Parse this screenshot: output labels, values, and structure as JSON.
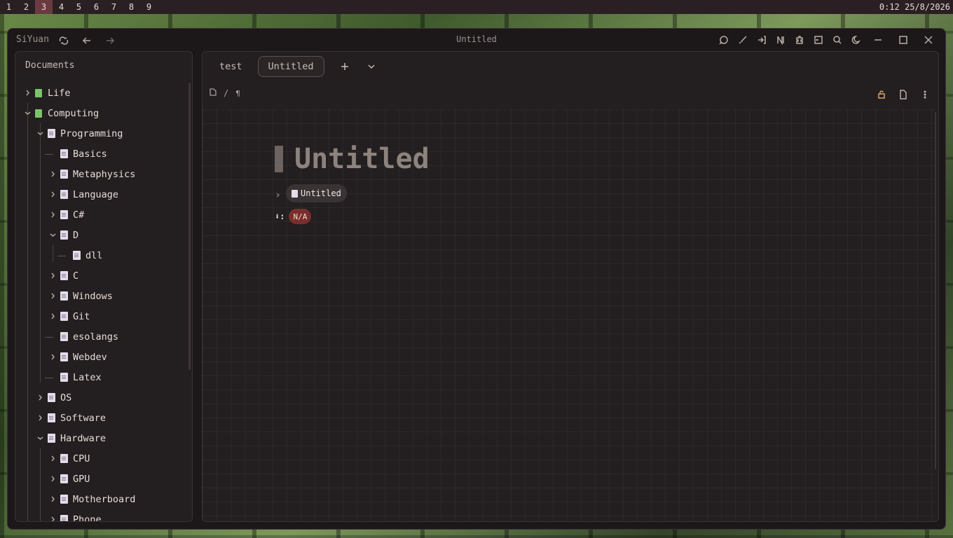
{
  "topbar": {
    "workspaces": [
      "1",
      "2",
      "3",
      "4",
      "5",
      "6",
      "7",
      "8",
      "9"
    ],
    "active_workspace": "3",
    "clock": "0:12 25/8/2026"
  },
  "window": {
    "app_name": "SiYuan",
    "title": "Untitled"
  },
  "sidebar": {
    "title": "Documents",
    "items": [
      {
        "label": "Life",
        "type": "notebook",
        "expanded": false
      },
      {
        "label": "Computing",
        "type": "notebook",
        "expanded": true
      },
      {
        "label": "Programming",
        "type": "doc",
        "expanded": true
      },
      {
        "label": "Basics",
        "type": "doc"
      },
      {
        "label": "Metaphysics",
        "type": "doc"
      },
      {
        "label": "Language",
        "type": "doc"
      },
      {
        "label": "C#",
        "type": "doc"
      },
      {
        "label": "D",
        "type": "doc",
        "expanded": true
      },
      {
        "label": "dll",
        "type": "doc"
      },
      {
        "label": "C",
        "type": "doc"
      },
      {
        "label": "Windows",
        "type": "doc"
      },
      {
        "label": "Git",
        "type": "doc"
      },
      {
        "label": "esolangs",
        "type": "doc"
      },
      {
        "label": "Webdev",
        "type": "doc"
      },
      {
        "label": "Latex",
        "type": "doc"
      },
      {
        "label": "OS",
        "type": "doc"
      },
      {
        "label": "Software",
        "type": "doc"
      },
      {
        "label": "Hardware",
        "type": "doc",
        "expanded": true
      },
      {
        "label": "CPU",
        "type": "doc"
      },
      {
        "label": "GPU",
        "type": "doc"
      },
      {
        "label": "Motherboard",
        "type": "doc"
      },
      {
        "label": "Phone",
        "type": "doc"
      }
    ]
  },
  "tabs": [
    {
      "label": "test",
      "active": false
    },
    {
      "label": "Untitled",
      "active": true
    }
  ],
  "breadcrumb": {
    "separator": "/"
  },
  "document": {
    "title": "Untitled",
    "child_link": "Untitled",
    "attribute_value": "N/A"
  },
  "colors": {
    "notebook_icon": "#7bc36a",
    "badge_bg": "#7a2e2c",
    "accent_icons": "#d0a56b"
  }
}
